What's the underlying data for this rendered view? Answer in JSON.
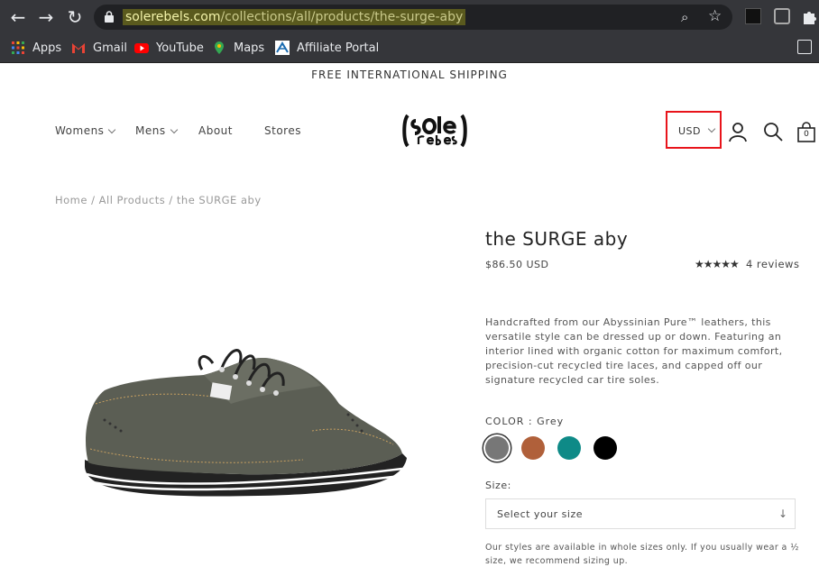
{
  "browser": {
    "url_host": "solerebels.com",
    "url_path": "/collections/all/products/the-surge-aby",
    "bookmarks": [
      {
        "label": "Apps",
        "icon": "apps-grid-icon"
      },
      {
        "label": "Gmail",
        "icon": "gmail-icon"
      },
      {
        "label": "YouTube",
        "icon": "youtube-icon"
      },
      {
        "label": "Maps",
        "icon": "maps-icon"
      },
      {
        "label": "Affiliate Portal",
        "icon": "affiliate-portal-icon"
      }
    ]
  },
  "promo": {
    "text": "FREE INTERNATIONAL SHIPPING"
  },
  "nav": {
    "womens": "Womens",
    "mens": "Mens",
    "about": "About",
    "stores": "Stores"
  },
  "header": {
    "currency": "USD",
    "cart_count": "0"
  },
  "breadcrumb": {
    "text": "Home / All Products / the SURGE aby"
  },
  "product": {
    "title": "the SURGE aby",
    "price": "$86.50 USD",
    "rating_stars": "★★★★★",
    "rating_value": 4.5,
    "reviews": "4 reviews",
    "description": "Handcrafted from our Abyssinian Pure™ leathers, this versatile style can be dressed up or down. Featuring an interior lined with organic cotton for maximum comfort, precision-cut recycled tire laces, and capped off our signature recycled car tire soles.",
    "color_label": "COLOR : Grey",
    "colors": [
      "#777777",
      "#b0603a",
      "#0e8a87",
      "#000000"
    ],
    "selected_color": "Grey",
    "size_label": "Size:",
    "size_placeholder": "Select your size",
    "size_note": "Our styles are available in whole sizes only. If you usually wear a ½ size, we recommend sizing up."
  },
  "colors": {
    "highlight": "#e8141b",
    "chrome_bg": "#35363a"
  }
}
